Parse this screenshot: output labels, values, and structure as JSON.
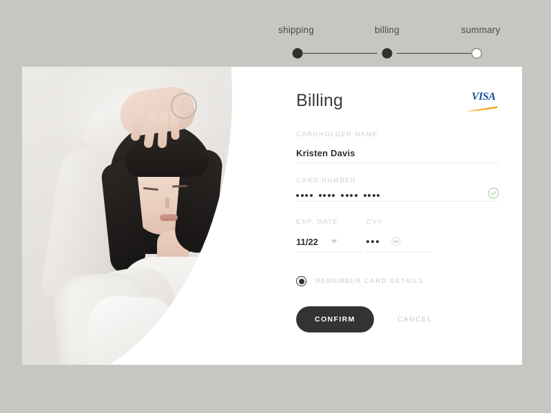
{
  "theme": {
    "background": "#c5c8c1",
    "card_background": "#ffffff",
    "accent_dark": "#333331",
    "label_gray": "#cfcfcf",
    "success_green": "#9ccb9c",
    "visa_blue": "#1a4f9c",
    "visa_gold": "#f0a616"
  },
  "stepper": {
    "steps": [
      {
        "label": "shipping",
        "state": "complete"
      },
      {
        "label": "billing",
        "state": "current"
      },
      {
        "label": "summary",
        "state": "upcoming"
      }
    ]
  },
  "photo": {
    "alt": "woman with short dark hair in white clothing raising her arm"
  },
  "form": {
    "title": "Billing",
    "card_brand": "VISA",
    "fields": {
      "cardholder": {
        "label": "CARDHOLDER NAME",
        "value": "Kristen Davis",
        "placeholder": "Cardholder name"
      },
      "card_number": {
        "label": "CARD NUMBER",
        "value": "•••• •••• •••• ••••",
        "placeholder": "Card number",
        "masked_groups": 4,
        "dots_per_group": 4,
        "valid": true,
        "validation_icon": "check-circle-icon"
      },
      "exp_date": {
        "label": "EXP. DATE",
        "value": "11/22",
        "dropdown_icon": "chevron-down-icon"
      },
      "cvv": {
        "label": "CVV",
        "value": "•••",
        "dots": 3,
        "reveal_icon": "eye-icon"
      }
    },
    "remember": {
      "label": "REMEMBER CARD DETAILS",
      "checked": true
    },
    "actions": {
      "confirm": "CONFIRM",
      "cancel": "CANCEL"
    }
  }
}
